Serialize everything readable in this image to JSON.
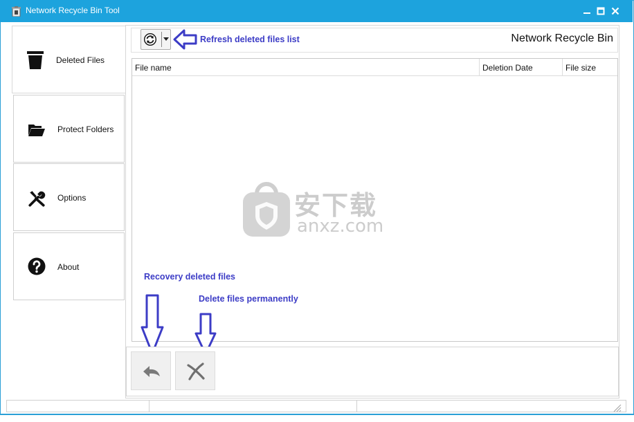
{
  "window": {
    "title": "Network Recycle Bin Tool",
    "minimize": "▬",
    "maximize": "▣",
    "close": "✕"
  },
  "sidebar": {
    "items": [
      {
        "label": "Deleted Files",
        "icon": "trash-icon",
        "active": true
      },
      {
        "label": "Protect Folders",
        "icon": "folder-open-icon",
        "active": false
      },
      {
        "label": "Options",
        "icon": "tools-icon",
        "active": false
      },
      {
        "label": "About",
        "icon": "question-icon",
        "active": false
      }
    ]
  },
  "toolbar": {
    "heading": "Network Recycle Bin",
    "refresh_icon": "refresh-icon"
  },
  "table": {
    "columns": [
      "File name",
      "Deletion Date",
      "File size"
    ],
    "rows": []
  },
  "actions": {
    "recover_icon": "undo-icon",
    "delete_icon": "delete-x-icon"
  },
  "annotations": {
    "refresh": "Refresh deleted files list",
    "recover": "Recovery deleted files",
    "delete": "Delete files permanently"
  },
  "watermark": {
    "cn": "安下载",
    "site": "anxz.com"
  },
  "colors": {
    "titlebar": "#1da3dd",
    "annotation": "#3c3cc6"
  }
}
